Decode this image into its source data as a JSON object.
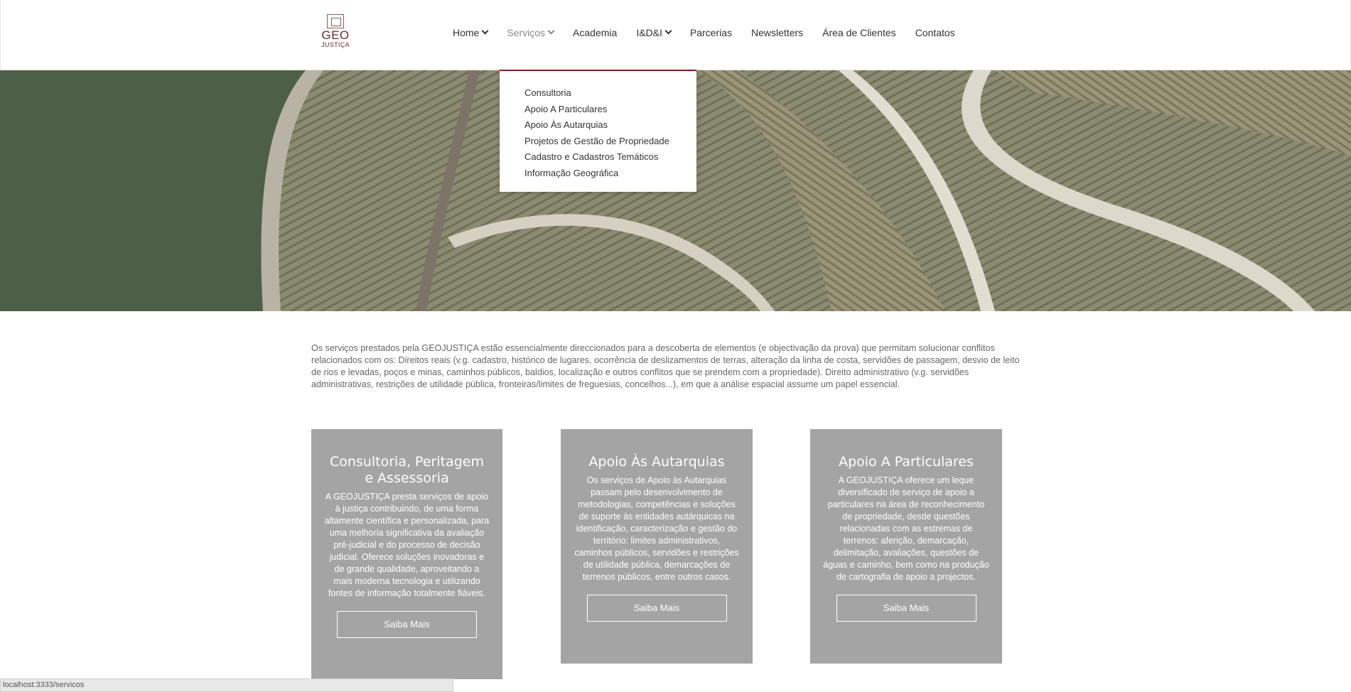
{
  "logo": {
    "line1": "GEO",
    "line2": "JUSTIÇA",
    "tagline": ""
  },
  "nav": {
    "items": [
      {
        "label": "Home",
        "has_dropdown": true
      },
      {
        "label": "Serviços",
        "has_dropdown": true
      },
      {
        "label": "Academia",
        "has_dropdown": false
      },
      {
        "label": "I&D&I",
        "has_dropdown": true
      },
      {
        "label": "Parcerias",
        "has_dropdown": false
      },
      {
        "label": "Newsletters",
        "has_dropdown": false
      },
      {
        "label": "Área de Clientes",
        "has_dropdown": false
      },
      {
        "label": "Contatos",
        "has_dropdown": false
      }
    ]
  },
  "dropdown": {
    "items": [
      "Consultoria",
      "Apoio A Particulares",
      "Apoio Às Autarquias",
      "Projetos de Gestão de Propriedade",
      "Cadastro e Cadastros Temáticos",
      "Informação Geográfica"
    ]
  },
  "intro": {
    "text": "Os serviços prestados pela GEOJUSTIÇA estão essencialmente direccionados para a descoberta de elementos (e objectivação da prova) que permitam solucionar conflitos relacionados com os: Direitos reais (v.g. cadastro, histórico de lugares, ocorrência de deslizamentos de terras, alteração da linha de costa, servidões de passagem, desvio de leito de rios e levadas, poços e minas, caminhos públicos, baldios, localização e outros conflitos que se prendem com a propriedade). Direito administrativo (v.g. servidões administrativas, restrições de utilidade pública, fronteiras/limites de freguesias, concelhos...), em que a análise espacial assume um papel essencial."
  },
  "cards": [
    {
      "title": "Consultoria, Peritagem e Assessoria",
      "text": "A GEOJUSTIÇA presta serviços de apoio à justiça contribuindo, de uma forma altamente científica e personalizada, para uma melhoria significativa da avaliação pré-judicial e do processo de decisão judicial. Oferece soluções inovadoras e de grande qualidade, aproveitando a mais moderna tecnologia e utilizando fontes de informação totalmente fiáveis.",
      "button": "Saiba Mais"
    },
    {
      "title": "Apoio Às Autarquias",
      "text": "Os serviços de Apoio às Autarquias passam pelo desenvolvimento de metodologias, competências e soluções de suporte às entidades autárquicas na identificação, caracterização e gestão do território: limites administrativos, caminhos públicos, servidões e restrições de utilidade pública, demarcações de terrenos públicos, entre outros casos.",
      "button": "Saiba Mais"
    },
    {
      "title": "Apoio A Particulares",
      "text": "A GEOJUSTIÇA oferece um leque diversificado de serviço de apoio a particulares na área de reconhecimento de propriedade, desde questões relacionadas com as estremas de terrenos: aferição, demarcação, delimitação, avaliações, questões de águas e caminho, bem como na produção de cartografia de apoio a projectos.",
      "button": "Saiba Mais"
    }
  ],
  "statusbar": {
    "url": "localhost:3333/servicos"
  },
  "colors": {
    "accent": "#8b1f1f",
    "card_bg": "#a4a4a4",
    "logo": "#6b2b2b"
  }
}
